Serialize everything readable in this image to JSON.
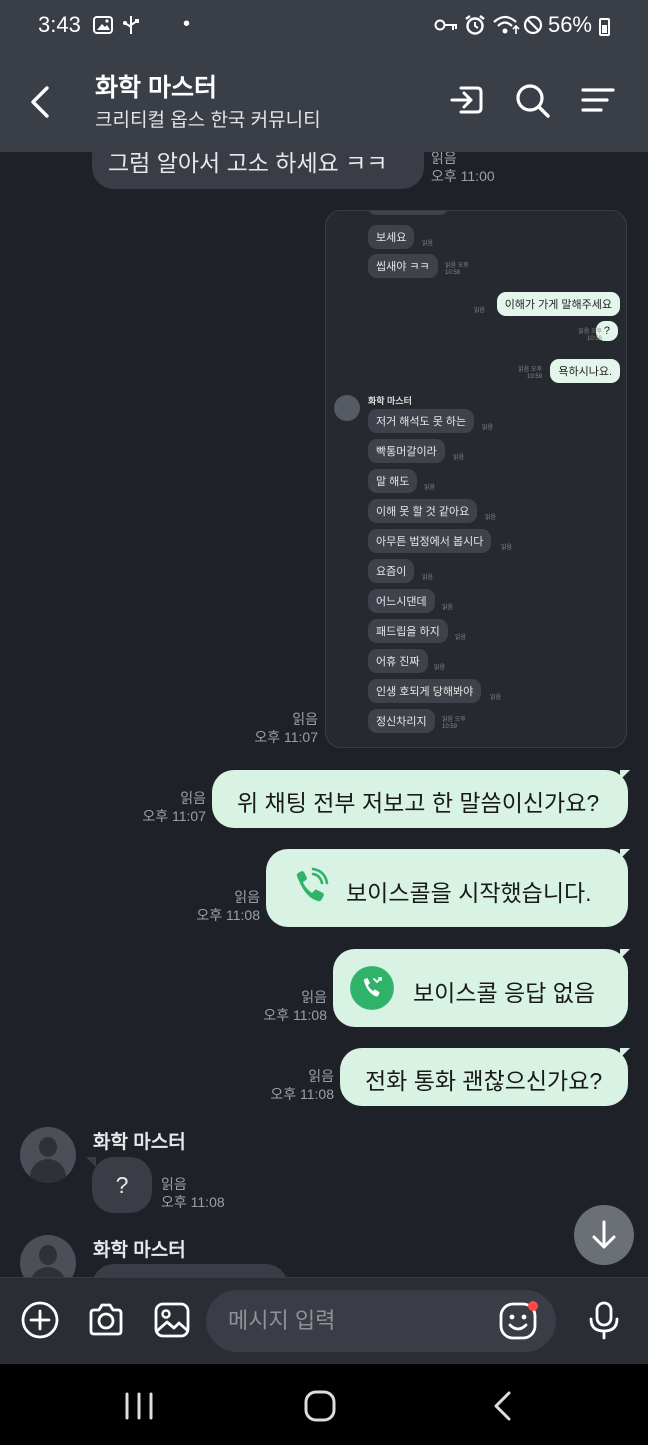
{
  "status_bar": {
    "time": "3:43",
    "battery": "56%",
    "icons": [
      "gallery-icon",
      "usb-icon",
      "dot-icon",
      "key-icon",
      "alarm-icon",
      "wifi-icon",
      "do-not-disturb-icon"
    ]
  },
  "header": {
    "title": "화학 마스터",
    "subtitle": "크리티컬 옵스 한국 커뮤니티",
    "icons": [
      "back-icon",
      "enter-icon",
      "search-icon",
      "menu-icon"
    ]
  },
  "messages": {
    "top_partial": {
      "text": "그럼 알아서 고소 하세요 ㅋㅋ",
      "read": "읽음",
      "time": "오후 11:00"
    },
    "image_msg": {
      "read": "읽음",
      "time": "오후 11:07"
    },
    "out1": {
      "text": "위 채팅 전부 저보고 한 말씀이신가요?",
      "read": "읽음",
      "time": "오후 11:07"
    },
    "out2": {
      "text": "보이스콜을 시작했습니다.",
      "read": "읽음",
      "time": "오후 11:08"
    },
    "out3": {
      "text": "보이스콜 응답 없음",
      "read": "읽음",
      "time": "오후 11:08"
    },
    "out4": {
      "text": "전화 통화 괜찮으신가요?",
      "read": "읽음",
      "time": "오후 11:08"
    },
    "in1": {
      "sender": "화학 마스터",
      "text": "?",
      "read": "읽음",
      "time": "오후 11:08"
    },
    "in2": {
      "sender": "화학 마스터"
    }
  },
  "embedded_screenshot": {
    "sender": "화학 마스터",
    "in_top": [
      {
        "text": "보세요",
        "meta": "읽음"
      },
      {
        "text": "씹새야 ㅋㅋ",
        "meta": "읽음 오후 10:58"
      }
    ],
    "out": [
      {
        "text": "이해가 가게 말해주세요",
        "meta": "읽음"
      },
      {
        "text": "?",
        "meta": "읽음 오후 10:58"
      },
      {
        "text": "욕하시나요.",
        "meta": "읽음 오후 10:59"
      }
    ],
    "in_bottom": [
      {
        "text": "저거 해석도 못 하는",
        "meta": "읽음"
      },
      {
        "text": "빡통머갈이라",
        "meta": "읽음"
      },
      {
        "text": "말 해도",
        "meta": "읽음"
      },
      {
        "text": "이해 못 할 것 같아요",
        "meta": "읽음"
      },
      {
        "text": "아무튼 법정에서 봅시다",
        "meta": "읽음"
      },
      {
        "text": "요즘이",
        "meta": "읽음"
      },
      {
        "text": "어느시댄데",
        "meta": "읽음"
      },
      {
        "text": "패드립을 하지",
        "meta": "읽음"
      },
      {
        "text": "어휴 진짜",
        "meta": "읽음"
      },
      {
        "text": "인생 호되게 당해봐야",
        "meta": "읽음"
      },
      {
        "text": "정신차리지",
        "meta": "읽음 오후 10:59"
      }
    ]
  },
  "input_bar": {
    "placeholder": "메시지 입력",
    "icons": [
      "add-icon",
      "camera-icon",
      "gallery-icon",
      "emoji-icon",
      "mic-icon"
    ]
  },
  "colors": {
    "background": "#1f2128",
    "header": "#3a3f47",
    "outgoing_bubble": "#d8f3e3",
    "incoming_bubble": "#3a3d45",
    "call_green": "#2fb36a"
  }
}
